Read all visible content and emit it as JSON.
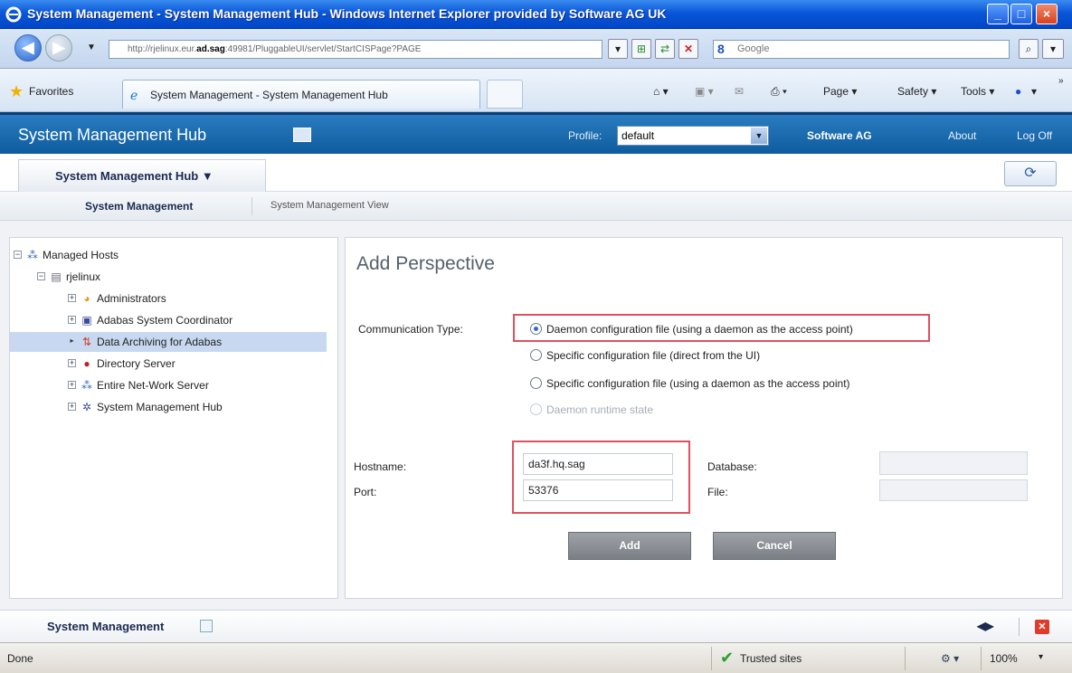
{
  "window": {
    "title": "System Management - System Management Hub - Windows Internet Explorer provided by Software AG UK",
    "controls": {
      "minimize": "_",
      "maximize": "□",
      "close": "×"
    }
  },
  "browser": {
    "address_prefix": "http://rjelinux.eur.",
    "address_bold": "ad.sag",
    "address_suffix": ":49981/PluggableUI/servlet/StartCISPage?PAGE",
    "search_placeholder": "Google",
    "favorites_label": "Favorites",
    "active_tab": "System Management - System Management Hub",
    "tools": {
      "page": "Page ▾",
      "safety": "Safety ▾",
      "tools": "Tools ▾",
      "help": "▾"
    }
  },
  "app": {
    "title": "System Management Hub",
    "profile_label": "Profile:",
    "profile_value": "default",
    "brand": "Software AG",
    "about": "About",
    "logoff": "Log Off",
    "hub_tab": "System Management Hub ▼",
    "subnav_active": "System Management",
    "subnav_other": "System Management View"
  },
  "tree": {
    "root": "Managed Hosts",
    "host": "rjelinux",
    "items": [
      {
        "label": "Administrators",
        "icon": "administrators-icon"
      },
      {
        "label": "Adabas System Coordinator",
        "icon": "coordinator-icon"
      },
      {
        "label": "Data Archiving for Adabas",
        "icon": "archiving-icon",
        "selected": true
      },
      {
        "label": "Directory Server",
        "icon": "directory-server-icon"
      },
      {
        "label": "Entire Net-Work Server",
        "icon": "network-server-icon"
      },
      {
        "label": "System Management Hub",
        "icon": "smh-icon"
      }
    ]
  },
  "form": {
    "title": "Add Perspective",
    "comm_label": "Communication Type:",
    "options": [
      {
        "label": "Daemon configuration file (using a daemon as the access point)",
        "checked": true,
        "disabled": false
      },
      {
        "label": "Specific configuration file (direct from the UI)",
        "checked": false,
        "disabled": false
      },
      {
        "label": "Specific configuration file (using a daemon as the access point)",
        "checked": false,
        "disabled": false
      },
      {
        "label": "Daemon runtime state",
        "checked": false,
        "disabled": true
      }
    ],
    "hostname_label": "Hostname:",
    "hostname_value": "da3f.hq.sag",
    "port_label": "Port:",
    "port_value": "53376",
    "database_label": "Database:",
    "file_label": "File:",
    "add_button": "Add",
    "cancel_button": "Cancel"
  },
  "bottom": {
    "label": "System Management",
    "arrows": "◀▶"
  },
  "status": {
    "done": "Done",
    "zone": "Trusted sites",
    "zoom": "100%"
  },
  "colors": {
    "header": "#0e5c9e",
    "highlight": "#e05060",
    "selected_row": "#c7d8f0"
  }
}
